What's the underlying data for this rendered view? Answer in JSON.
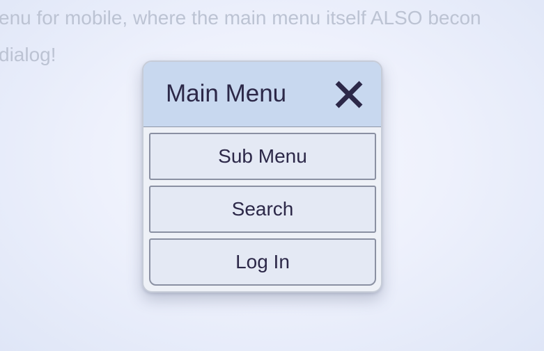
{
  "background": {
    "lines": [
      "enu for mobile, where the main menu itself ALSO becon",
      "dialog!"
    ]
  },
  "dialog": {
    "title": "Main Menu",
    "close_icon": "close-x-icon",
    "items": [
      {
        "label": "Sub Menu"
      },
      {
        "label": "Search"
      },
      {
        "label": "Log In"
      }
    ]
  },
  "colors": {
    "header_bg": "#c8d8ef",
    "text": "#2c2848",
    "item_bg": "#e4e9f4",
    "item_border": "#8a90a2",
    "background_text": "#bcc3d3"
  }
}
